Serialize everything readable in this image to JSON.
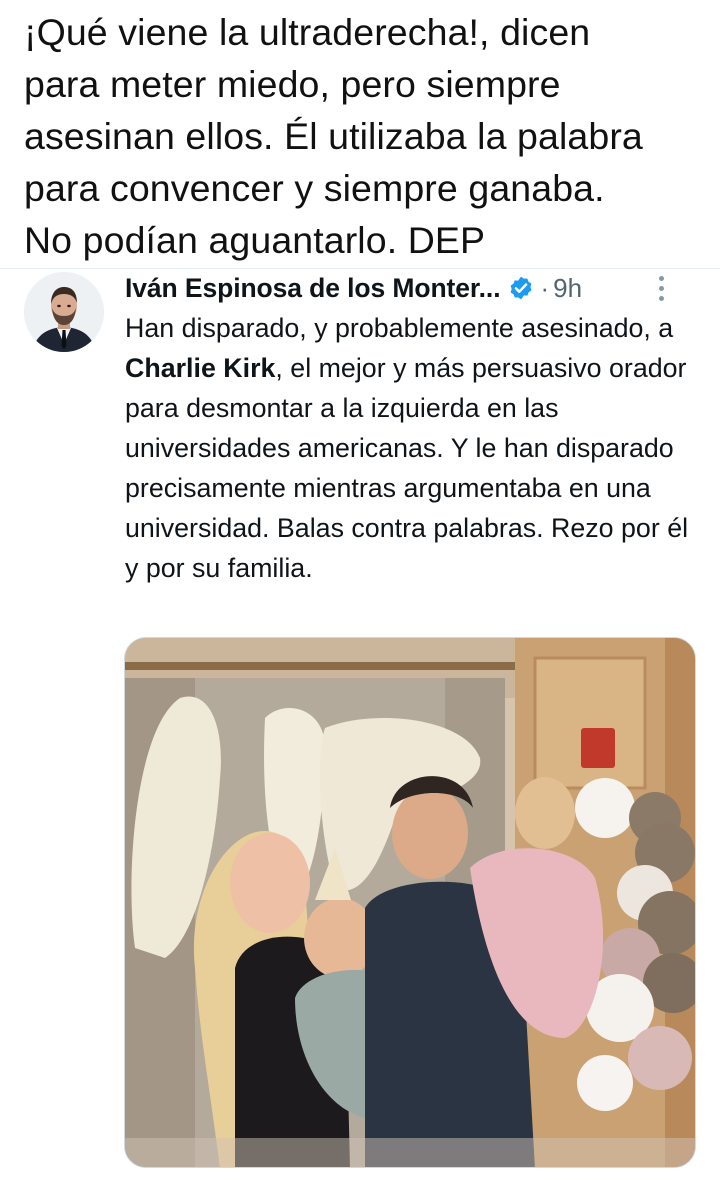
{
  "caption": {
    "lines": [
      "¡Qué viene la ultraderecha!, dicen",
      "para meter miedo, pero siempre",
      "asesinan ellos. Él utilizaba la palabra",
      "para convencer y siempre ganaba.",
      "No podían aguantarlo. DEP"
    ]
  },
  "tweet": {
    "display_name": "Iván Espinosa de los Monter...",
    "verified_icon": "verified-badge-icon",
    "separator": "·",
    "time": "9h",
    "more_icon": "more-vertical-icon",
    "text_parts": {
      "before": "Han disparado, y probablemente asesinado, a ",
      "bold": "Charlie Kirk",
      "after": ", el mejor y más persuasivo orador para desmontar a la izquierda en las universidades americanas. Y le han disparado precisamente mientras argumentaba en una universidad. Balas contra palabras. Rezo por él y por su familia."
    }
  },
  "colors": {
    "text": "#0f1419",
    "secondary": "#536471",
    "verified": "#1d9bf0",
    "border": "#cfd9de"
  }
}
